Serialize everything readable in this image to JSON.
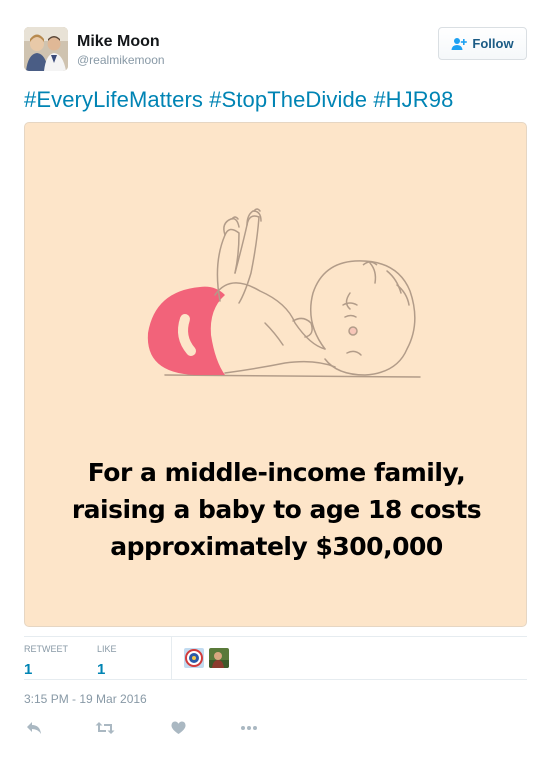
{
  "tweet": {
    "author": {
      "display_name": "Mike Moon",
      "handle": "@realmikemoon"
    },
    "follow_label": "Follow",
    "text": "#EveryLifeMatters #StopTheDivide #HJR98",
    "image": {
      "caption_lines": [
        "For a middle-income family,",
        "raising a baby to age 18 costs",
        "approximately $300,000"
      ]
    },
    "stats": {
      "retweet_label": "RETWEET",
      "retweet_count": "1",
      "like_label": "LIKE",
      "like_count": "1"
    },
    "timestamp": "3:15 PM - 19 Mar 2016",
    "actions": [
      "reply-icon",
      "retweet-icon",
      "heart-icon",
      "more-icon"
    ]
  },
  "colors": {
    "link": "#0084b4",
    "image_bg": "#fde5c9",
    "diaper": "#f2637a",
    "muted": "#8899a6"
  }
}
